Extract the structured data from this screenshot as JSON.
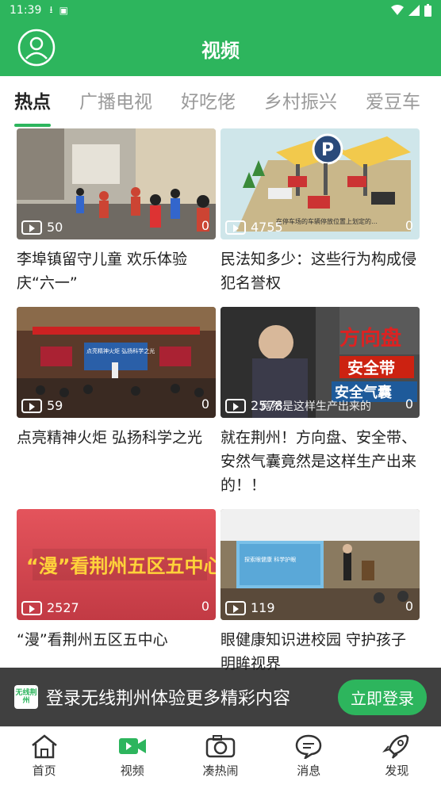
{
  "status": {
    "time": "11:39"
  },
  "header": {
    "title": "视频"
  },
  "tabs": [
    "热点",
    "广播电视",
    "好吃佬",
    "乡村振兴",
    "爱豆车"
  ],
  "videos": [
    {
      "title": "李埠镇留守儿童 欢乐体验庆“六一”",
      "views": "50",
      "comments": "0"
    },
    {
      "title": "民法知多少：这些行为构成侵犯名誉权",
      "views": "4755",
      "comments": "0"
    },
    {
      "title": "点亮精神火炬 弘扬科学之光",
      "views": "59",
      "comments": "0"
    },
    {
      "title": "就在荆州！方向盘、安全带、安然气囊竟然是这样生产出来的！！",
      "views": "2578",
      "comments": "0"
    },
    {
      "title": "“漫”看荆州五区五中心",
      "views": "2527",
      "comments": "0"
    },
    {
      "title": "眼健康知识进校园 守护孩子明眸视界",
      "views": "119",
      "comments": "0"
    }
  ],
  "thumb_text": {
    "v2_caption": "在停车场的车辆停放位置上划定的…",
    "v3_banner": "点亮精神火炬 弘扬科学之光",
    "v4_line1": "方向盘",
    "v4_line2": "安全带",
    "v4_line3": "安全气囊",
    "v4_caption": "竟然是这样生产出来的",
    "v5_title": "“漫”看荆州五区五中心",
    "v6_screen": "探索眼健康 科学护眼"
  },
  "login_banner": {
    "logo": "无线荆州",
    "text": "登录无线荆州体验更多精彩内容",
    "button": "立即登录"
  },
  "bottom_nav": [
    {
      "label": "首页",
      "icon": "home-icon"
    },
    {
      "label": "视频",
      "icon": "video-icon"
    },
    {
      "label": "凑热闹",
      "icon": "camera-icon"
    },
    {
      "label": "消息",
      "icon": "message-icon"
    },
    {
      "label": "发现",
      "icon": "rocket-icon"
    }
  ],
  "colors": {
    "accent": "#2db55d"
  }
}
